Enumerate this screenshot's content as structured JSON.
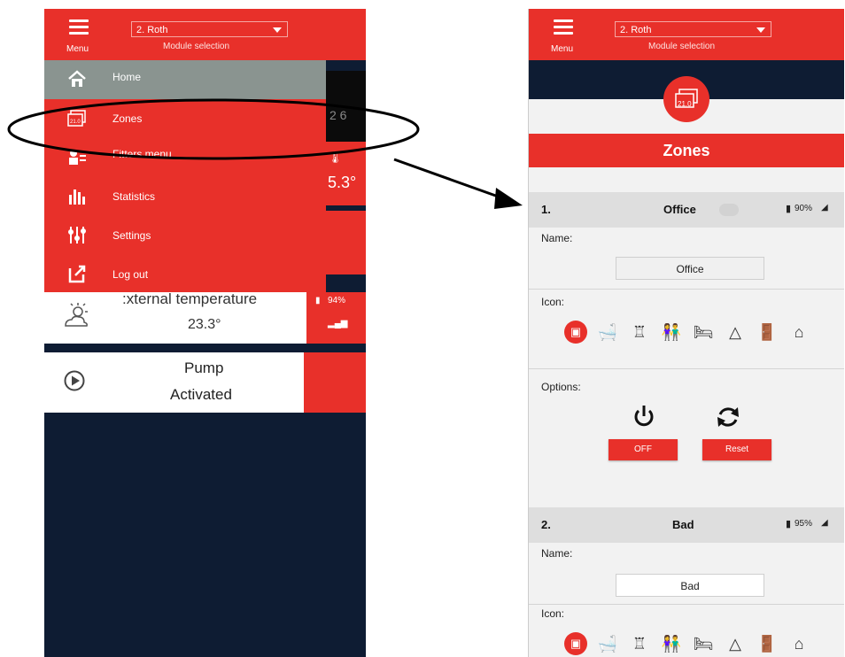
{
  "left": {
    "header": {
      "menu_label": "Menu",
      "module_value": "2. Roth",
      "module_label": "Module selection"
    },
    "nav": [
      {
        "label": "Home",
        "icon": "home-icon"
      },
      {
        "label": "Zones",
        "icon": "zones-icon"
      },
      {
        "label": "Fitters menu",
        "icon": "fitter-icon"
      },
      {
        "label": "Statistics",
        "icon": "statistics-icon"
      },
      {
        "label": "Settings",
        "icon": "settings-icon"
      },
      {
        "label": "Log out",
        "icon": "logout-icon"
      }
    ],
    "bg_tiles": {
      "partial_digit": "2 6",
      "temperature": "5.3°"
    },
    "external": {
      "title": ":xternal temperature",
      "value": "23.3°",
      "battery": "94%"
    },
    "pump": {
      "title": "Pump",
      "status": "Activated"
    }
  },
  "right": {
    "header": {
      "menu_label": "Menu",
      "module_value": "2. Roth",
      "module_label": "Module selection"
    },
    "hero_badge": "21.0",
    "section_title": "Zones",
    "zones": [
      {
        "number": "1.",
        "name": "Office",
        "battery": "90%",
        "name_label": "Name:",
        "name_value": "Office",
        "icon_label": "Icon:"
      },
      {
        "number": "2.",
        "name": "Bad",
        "battery": "95%",
        "name_label": "Name:",
        "name_value": "Bad",
        "icon_label": "Icon:"
      }
    ],
    "options": {
      "label": "Options:",
      "off_label": "OFF",
      "reset_label": "Reset"
    }
  },
  "colors": {
    "brand_red": "#e8302a",
    "navy": "#0e1c33",
    "gray_header": "#8a9490"
  }
}
